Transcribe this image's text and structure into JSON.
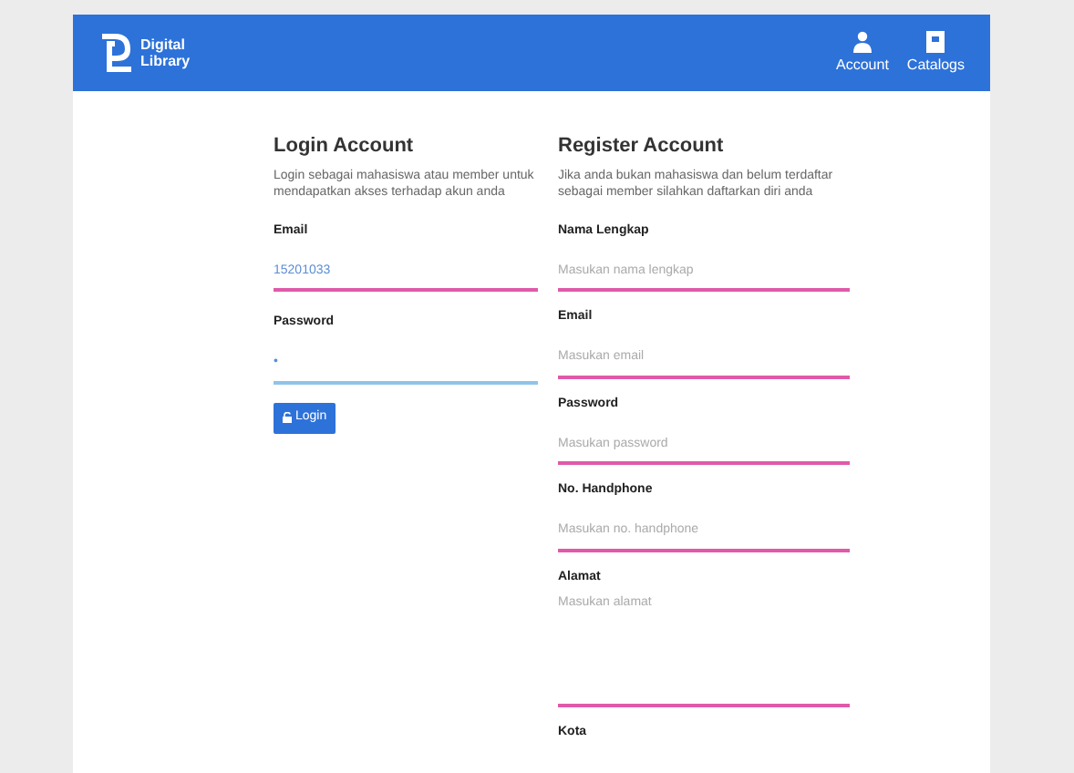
{
  "header": {
    "logo_line1": "Digital",
    "logo_line2": "Library",
    "nav": [
      {
        "label": "Account",
        "kind": "user"
      },
      {
        "label": "Catalogs",
        "kind": "book"
      }
    ]
  },
  "login": {
    "title": "Login Account",
    "description": "Login sebagai mahasiswa atau member untuk mendapatkan akses terhadap akun anda",
    "fields": [
      {
        "label": "Email",
        "value": "15201033",
        "focused": false
      },
      {
        "label": "Password",
        "value": "•",
        "focused": true
      }
    ],
    "button": "Login"
  },
  "register": {
    "title": "Register Account",
    "description": "Jika anda bukan mahasiswa dan belum terdaftar sebagai member silahkan daftarkan diri anda",
    "fields": [
      {
        "label": "Nama Lengkap",
        "placeholder": "Masukan nama lengkap",
        "kind": "input"
      },
      {
        "label": "Email",
        "placeholder": "Masukan email",
        "kind": "input"
      },
      {
        "label": "Password",
        "placeholder": "Masukan password",
        "kind": "input"
      },
      {
        "label": "No. Handphone",
        "placeholder": "Masukan no. handphone",
        "kind": "input"
      },
      {
        "label": "Alamat",
        "placeholder": "Masukan alamat",
        "kind": "textarea"
      },
      {
        "label": "Kota",
        "kind": "label"
      }
    ]
  }
}
